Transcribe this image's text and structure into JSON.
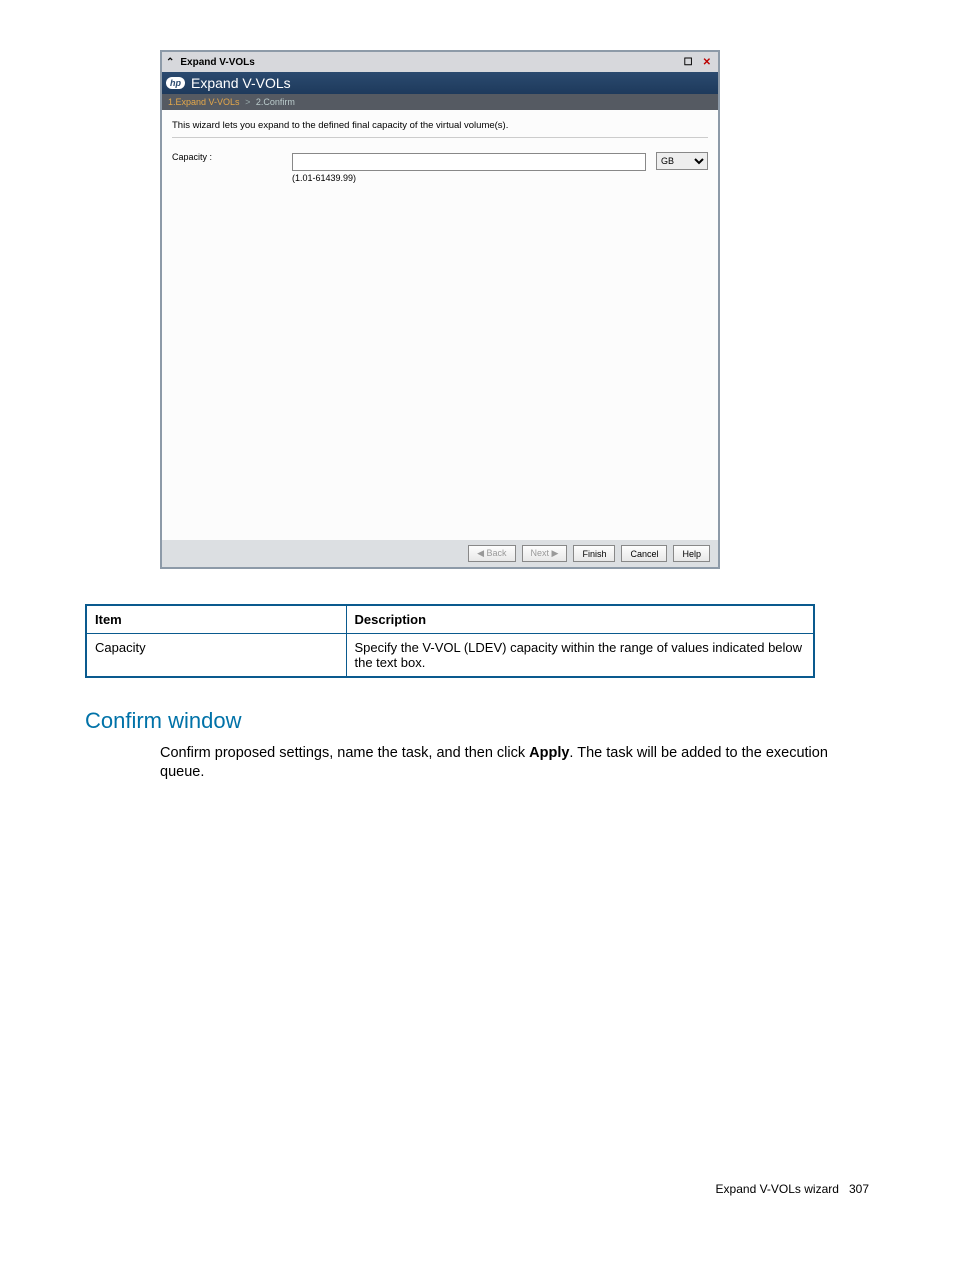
{
  "window": {
    "outer_title": "Expand V-VOLs",
    "banner_title": "Expand V-VOLs"
  },
  "breadcrumb": {
    "step1": "1.Expand V-VOLs",
    "sep": ">",
    "step2": "2.Confirm"
  },
  "wizard": {
    "description": "This wizard lets you expand to the defined final capacity of the virtual volume(s).",
    "capacity_label": "Capacity :",
    "range_hint": "(1.01-61439.99)",
    "unit_selected": "GB"
  },
  "buttons": {
    "back": "◀ Back",
    "next": "Next ▶",
    "finish": "Finish",
    "cancel": "Cancel",
    "help": "Help"
  },
  "table": {
    "header_item": "Item",
    "header_desc": "Description",
    "rows": [
      {
        "item": "Capacity",
        "desc": "Specify the V-VOL (LDEV) capacity within the range of values indicated below the text box."
      }
    ]
  },
  "section": {
    "heading": "Confirm window",
    "text_before": "Confirm proposed settings, name the task, and then click ",
    "text_bold": "Apply",
    "text_after": ". The task will be added to the execution queue."
  },
  "footer": {
    "label": "Expand V-VOLs wizard",
    "page": "307"
  }
}
